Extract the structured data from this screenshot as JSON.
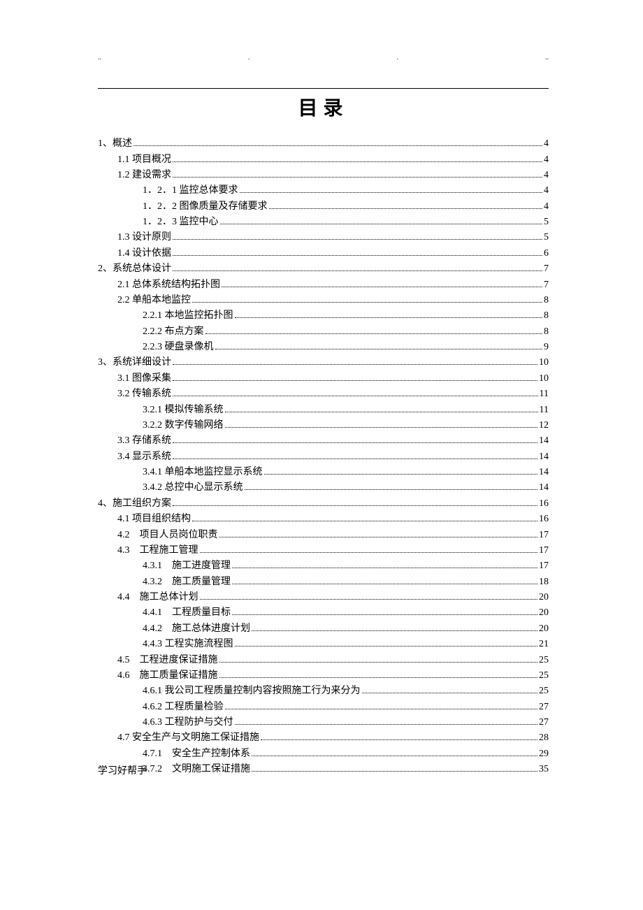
{
  "title": "目录",
  "header_dots": [
    "..",
    ".",
    ".",
    ".."
  ],
  "footer": "学习好帮手",
  "toc": [
    {
      "level": 0,
      "label": "1、概述",
      "page": "4"
    },
    {
      "level": 1,
      "label": "1.1 项目概况",
      "page": "4"
    },
    {
      "level": 1,
      "label": "1.2 建设需求",
      "page": "4"
    },
    {
      "level": 2,
      "label": "1．2．1 监控总体要求",
      "page": "4"
    },
    {
      "level": 2,
      "label": "1．2．2 图像质量及存储要求",
      "page": "4"
    },
    {
      "level": 2,
      "label": "1．2．3 监控中心",
      "page": "5"
    },
    {
      "level": 1,
      "label": "1.3 设计原则",
      "page": "5"
    },
    {
      "level": 1,
      "label": "1.4 设计依据",
      "page": "6"
    },
    {
      "level": 0,
      "label": "2、系统总体设计",
      "page": "7"
    },
    {
      "level": 1,
      "label": "2.1 总体系统结构拓扑图",
      "page": "7"
    },
    {
      "level": 1,
      "label": "2.2 单船本地监控",
      "page": "8"
    },
    {
      "level": 2,
      "label": "2.2.1 本地监控拓扑图",
      "page": "8"
    },
    {
      "level": 2,
      "label": "2.2.2 布点方案",
      "page": "8"
    },
    {
      "level": 2,
      "label": "2.2.3 硬盘录像机",
      "page": "9"
    },
    {
      "level": 0,
      "label": "3、系统详细设计",
      "page": "10"
    },
    {
      "level": 1,
      "label": "3.1 图像采集",
      "page": "10"
    },
    {
      "level": 1,
      "label": "3.2 传输系统",
      "page": "11"
    },
    {
      "level": 2,
      "label": "3.2.1 模拟传输系统",
      "page": "11"
    },
    {
      "level": 2,
      "label": "3.2.2  数字传输网络",
      "page": "12"
    },
    {
      "level": 1,
      "label": "3.3 存储系统",
      "page": "14"
    },
    {
      "level": 1,
      "label": "3.4 显示系统",
      "page": "14"
    },
    {
      "level": 2,
      "label": "3.4.1 单船本地监控显示系统",
      "page": "14"
    },
    {
      "level": 2,
      "label": "3.4.2 总控中心显示系统",
      "page": "14"
    },
    {
      "level": 0,
      "label": "4、施工组织方案",
      "page": "16"
    },
    {
      "level": 1,
      "label": "4.1 项目组织结构",
      "page": "16"
    },
    {
      "level": 1,
      "label": "4.2　项目人员岗位职责",
      "page": "17"
    },
    {
      "level": 1,
      "label": "4.3　工程施工管理",
      "page": "17"
    },
    {
      "level": 2,
      "label": "4.3.1　施工进度管理",
      "page": "17"
    },
    {
      "level": 2,
      "label": "4.3.2　施工质量管理",
      "page": "18"
    },
    {
      "level": 1,
      "label": "4.4　施工总体计划",
      "page": "20"
    },
    {
      "level": 2,
      "label": "4.4.1　工程质量目标",
      "page": "20"
    },
    {
      "level": 2,
      "label": "4.4.2　施工总体进度计划",
      "page": "20"
    },
    {
      "level": 2,
      "label": "4.4.3 工程实施流程图",
      "page": "21"
    },
    {
      "level": 1,
      "label": "4.5　工程进度保证措施",
      "page": "25"
    },
    {
      "level": 1,
      "label": "4.6　施工质量保证措施",
      "page": "25"
    },
    {
      "level": 2,
      "label": "4.6.1  我公司工程质量控制内容按照施工行为来分为",
      "page": "25"
    },
    {
      "level": 2,
      "label": "4.6.2 工程质量检验",
      "page": "27"
    },
    {
      "level": 2,
      "label": "4.6.3 工程防护与交付",
      "page": "27"
    },
    {
      "level": 1,
      "label": "4.7  安全生产与文明施工保证措施",
      "page": "28"
    },
    {
      "level": 2,
      "label": "4.7.1　安全生产控制体系",
      "page": "29"
    },
    {
      "level": 2,
      "label": "4.7.2　文明施工保证措施",
      "page": "35"
    }
  ]
}
